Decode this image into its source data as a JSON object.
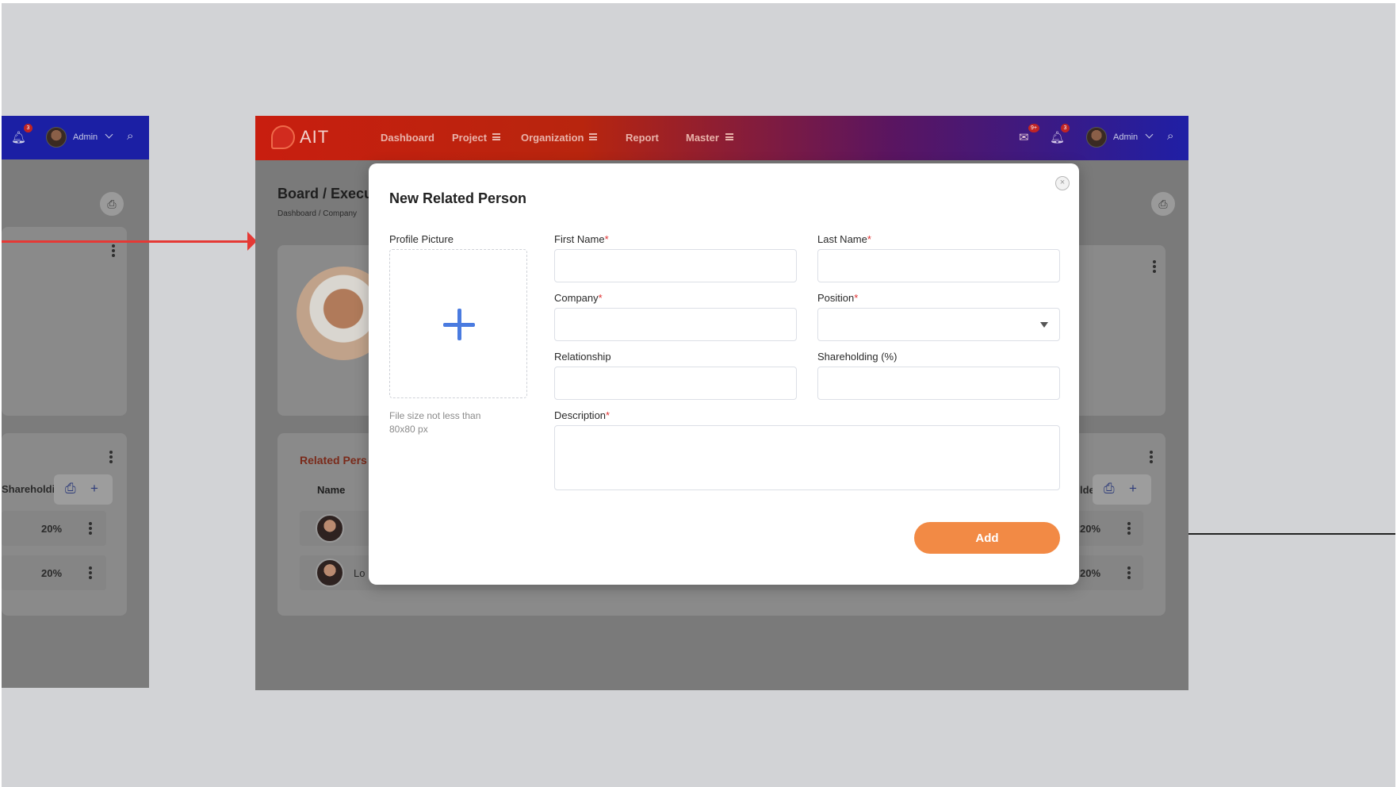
{
  "main": {
    "logo": "AIT",
    "nav": {
      "dashboard": "Dashboard",
      "project": "Project",
      "organization": "Organization",
      "report": "Report",
      "master": "Master"
    },
    "user": {
      "name": "Admin"
    },
    "notifications": {
      "mail_badge": "9+",
      "bell_badge": "3"
    },
    "page_title": "Board / Execu",
    "breadcrumb": "Dashboard / Company",
    "related_title": "Related Pers",
    "table": {
      "name_header": "Name",
      "row2_partial": "Lo"
    }
  },
  "left": {
    "user": {
      "name": "Admin"
    },
    "bell_badge": "3",
    "table": {
      "header_partial": "Shareholdi",
      "rows": [
        {
          "shareholding": "20%"
        },
        {
          "shareholding": "20%"
        }
      ]
    }
  },
  "right_partial": {
    "header_partial": "lde",
    "rows": [
      {
        "shareholding": "20%"
      },
      {
        "shareholding": "20%"
      }
    ]
  },
  "modal": {
    "title": "New Related Person",
    "profile_picture_label": "Profile Picture",
    "upload_hint": "File size not less than 80x80 px",
    "required_mark": "*",
    "fields": {
      "first_name": {
        "label": "First Name",
        "value": ""
      },
      "last_name": {
        "label": "Last Name",
        "value": ""
      },
      "company": {
        "label": "Company",
        "value": ""
      },
      "position": {
        "label": "Position",
        "value": ""
      },
      "relationship": {
        "label": "Relationship",
        "value": ""
      },
      "shareholding": {
        "label": "Shareholding (%)",
        "value": ""
      },
      "description": {
        "label": "Description",
        "value": ""
      }
    },
    "add_label": "Add",
    "close_glyph": "×"
  },
  "colors": {
    "topbar_red": "#c81e0f",
    "topbar_blue": "#1f1fa5",
    "primary_button": "#f28a45",
    "required": "#e03030",
    "upload_plus": "#4a7be0",
    "annotation_arrow": "#e53935"
  },
  "icons": {
    "search": "search-icon",
    "bell": "bell-icon",
    "mail": "mail-icon",
    "print": "print-icon",
    "add": "plus-icon",
    "menu": "hamburger-icon",
    "more": "kebab-icon"
  }
}
